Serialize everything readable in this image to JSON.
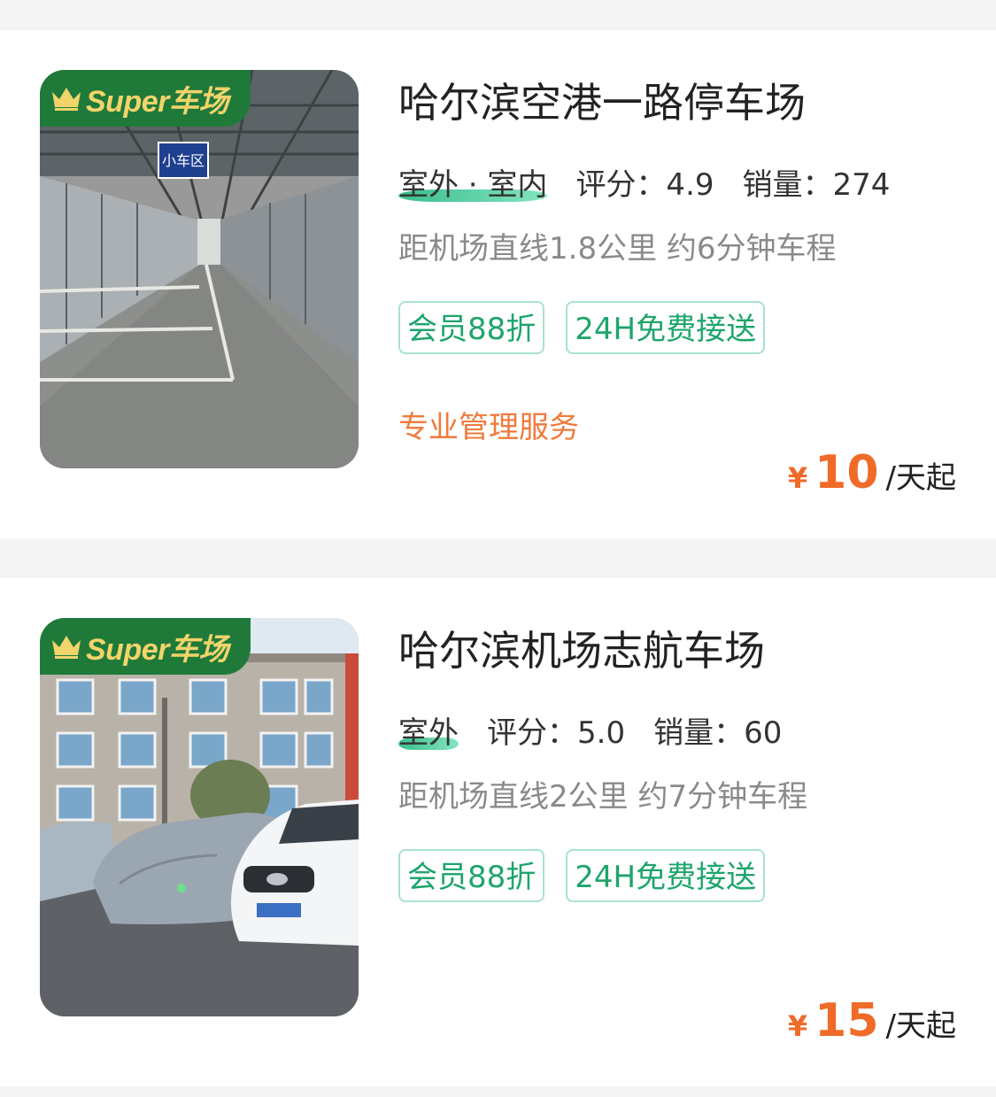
{
  "listings": [
    {
      "badge_text": "Super车场",
      "title": "哈尔滨空港一路停车场",
      "type": "室外 · 室内",
      "score": "评分：4.9",
      "sales": "销量：274",
      "distance": "距机场直线1.8公里 约6分钟车程",
      "tags": [
        "会员88折",
        "24H免费接送"
      ],
      "promo": "专业管理服务",
      "currency": "¥",
      "price": "10",
      "price_unit": "/天起",
      "image_icon": "parking-garage-photo"
    },
    {
      "badge_text": "Super车场",
      "title": "哈尔滨机场志航车场",
      "type": "室外",
      "score": "评分：5.0",
      "sales": "销量：60",
      "distance": "距机场直线2公里 约7分钟车程",
      "tags": [
        "会员88折",
        "24H免费接送"
      ],
      "promo": "",
      "currency": "¥",
      "price": "15",
      "price_unit": "/天起",
      "image_icon": "outdoor-parking-photo"
    }
  ],
  "photo_sign_text": "小车区",
  "colors": {
    "badge_green": "#1f7a3a",
    "badge_gold": "#f2d46a",
    "tag_green": "#1ea56b",
    "tag_border": "#a8e3cb",
    "promo_orange": "#f07a3d",
    "price_orange": "#f06a28"
  }
}
